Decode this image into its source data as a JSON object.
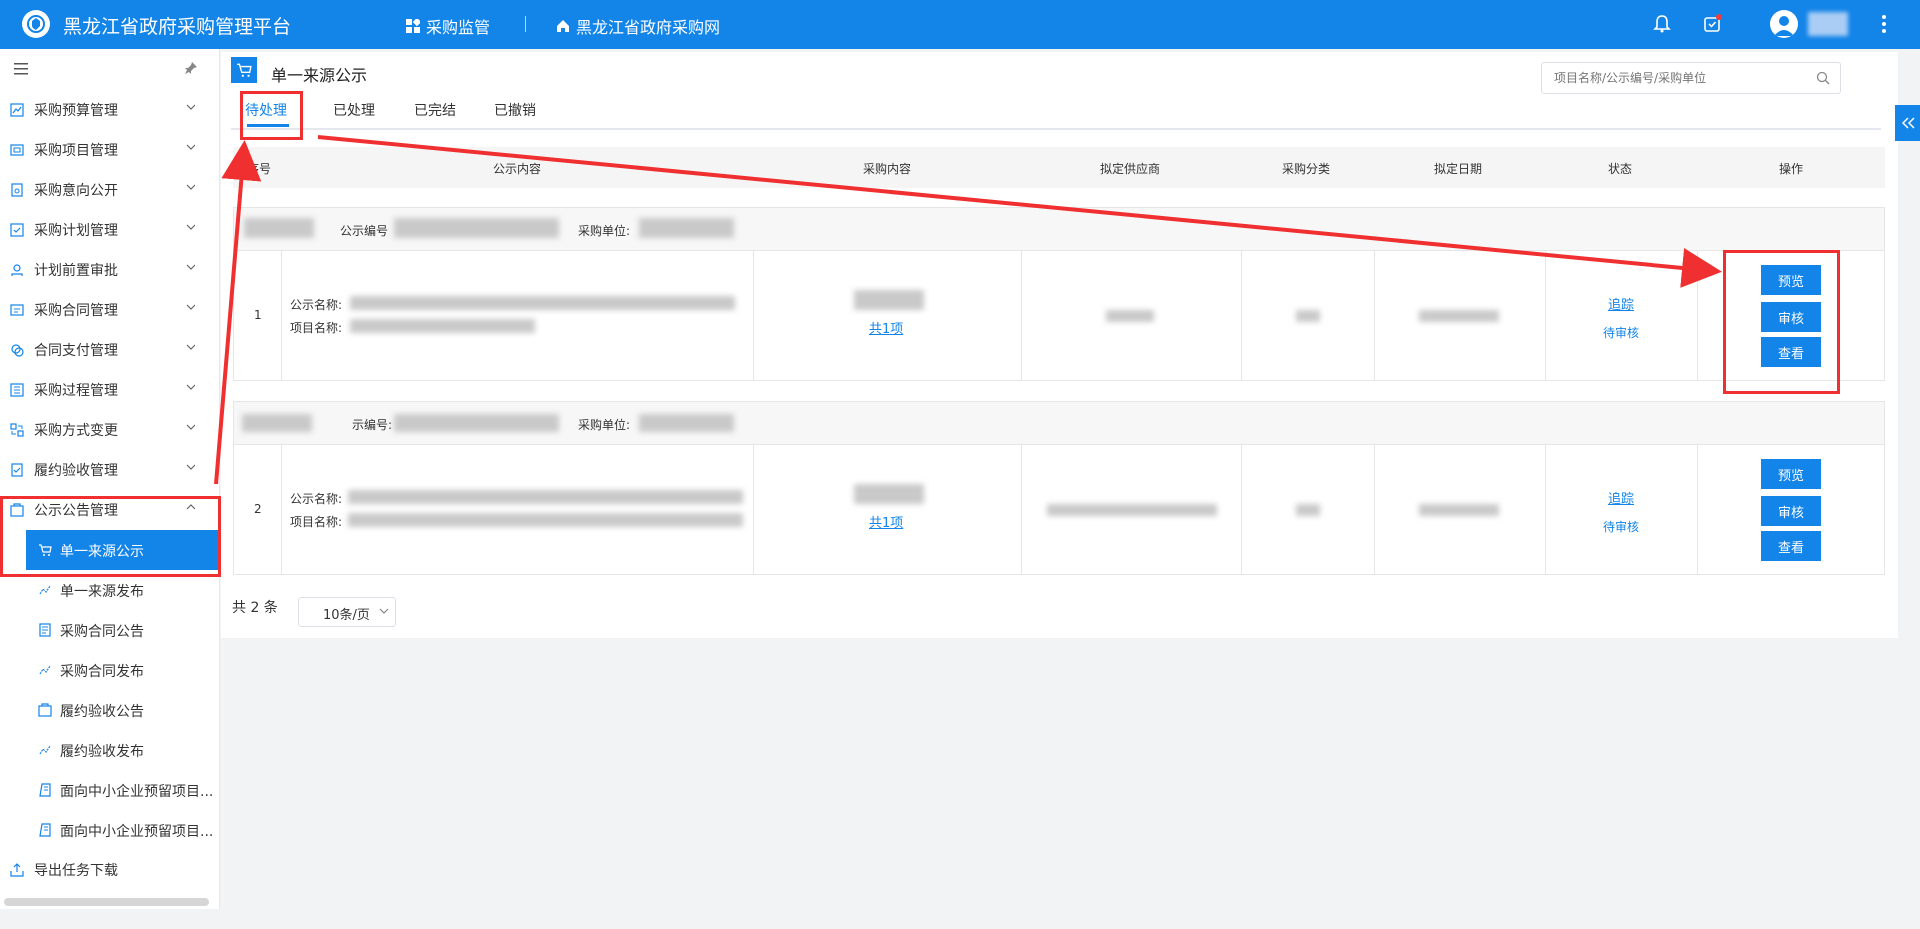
{
  "header": {
    "app_title": "黑龙江省政府采购管理平台",
    "nav": [
      {
        "label": "采购监管",
        "icon": "grid-icon"
      },
      {
        "label": "黑龙江省政府采购网",
        "icon": "home-icon"
      }
    ]
  },
  "sidebar": {
    "items": [
      {
        "label": "采购预算管理"
      },
      {
        "label": "采购项目管理"
      },
      {
        "label": "采购意向公开"
      },
      {
        "label": "采购计划管理"
      },
      {
        "label": "计划前置审批"
      },
      {
        "label": "采购合同管理"
      },
      {
        "label": "合同支付管理"
      },
      {
        "label": "采购过程管理"
      },
      {
        "label": "采购方式变更"
      },
      {
        "label": "履约验收管理"
      },
      {
        "label": "公示公告管理"
      }
    ],
    "sub_items": [
      {
        "label": "单一来源公示"
      },
      {
        "label": "单一来源发布"
      },
      {
        "label": "采购合同公告"
      },
      {
        "label": "采购合同发布"
      },
      {
        "label": "履约验收公告"
      },
      {
        "label": "履约验收发布"
      },
      {
        "label": "面向中小企业预留项目..."
      },
      {
        "label": "面向中小企业预留项目..."
      }
    ],
    "bottom_item": {
      "label": "导出任务下载"
    }
  },
  "page": {
    "title": "单一来源公示",
    "search_placeholder": "项目名称/公示编号/采购单位",
    "tabs": [
      "待处理",
      "已处理",
      "已完结",
      "已撤销"
    ]
  },
  "table": {
    "columns": [
      "序号",
      "公示内容",
      "采购内容",
      "拟定供应商",
      "采购分类",
      "拟定日期",
      "状态",
      "操作"
    ],
    "group_labels": {
      "notice_no_a": "公示编号",
      "notice_no_b": "示编号:",
      "unit": "采购单位:"
    },
    "row_labels": {
      "notice_name": "公示名称:",
      "project_name": "项目名称:"
    },
    "rows": [
      {
        "index": "1",
        "content_link": "共1项",
        "track": "追踪",
        "status": "待审核"
      },
      {
        "index": "2",
        "content_link": "共1项",
        "track": "追踪",
        "status": "待审核"
      }
    ],
    "actions": [
      "预览",
      "审核",
      "查看"
    ]
  },
  "pagination": {
    "total": "共 2 条",
    "page_size": "10条/页"
  },
  "colors": {
    "primary": "#1384e8",
    "annotation_red": "#f03030"
  }
}
